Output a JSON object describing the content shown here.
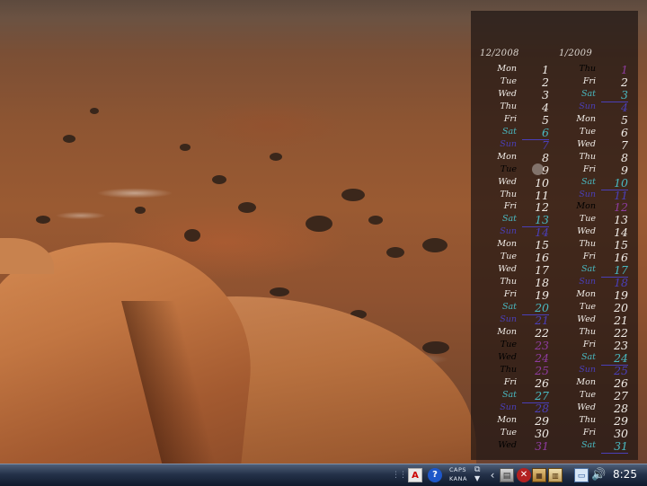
{
  "calendar": {
    "months": [
      {
        "heading": "12/2008",
        "days": [
          {
            "name": "Mon",
            "date": "1",
            "kind": "weekday"
          },
          {
            "name": "Tue",
            "date": "2",
            "kind": "weekday"
          },
          {
            "name": "Wed",
            "date": "3",
            "kind": "weekday"
          },
          {
            "name": "Thu",
            "date": "4",
            "kind": "weekday"
          },
          {
            "name": "Fri",
            "date": "5",
            "kind": "weekday"
          },
          {
            "name": "Sat",
            "date": "6",
            "kind": "sat"
          },
          {
            "name": "Sun",
            "date": "7",
            "kind": "sun"
          },
          {
            "name": "Mon",
            "date": "8",
            "kind": "weekday"
          },
          {
            "name": "Tue",
            "date": "9",
            "kind": "today"
          },
          {
            "name": "Wed",
            "date": "10",
            "kind": "weekday"
          },
          {
            "name": "Thu",
            "date": "11",
            "kind": "weekday"
          },
          {
            "name": "Fri",
            "date": "12",
            "kind": "weekday"
          },
          {
            "name": "Sat",
            "date": "13",
            "kind": "sat"
          },
          {
            "name": "Sun",
            "date": "14",
            "kind": "sun"
          },
          {
            "name": "Mon",
            "date": "15",
            "kind": "weekday"
          },
          {
            "name": "Tue",
            "date": "16",
            "kind": "weekday"
          },
          {
            "name": "Wed",
            "date": "17",
            "kind": "weekday"
          },
          {
            "name": "Thu",
            "date": "18",
            "kind": "weekday"
          },
          {
            "name": "Fri",
            "date": "19",
            "kind": "weekday"
          },
          {
            "name": "Sat",
            "date": "20",
            "kind": "sat"
          },
          {
            "name": "Sun",
            "date": "21",
            "kind": "sun"
          },
          {
            "name": "Mon",
            "date": "22",
            "kind": "weekday"
          },
          {
            "name": "Tue",
            "date": "23",
            "kind": "holiday"
          },
          {
            "name": "Wed",
            "date": "24",
            "kind": "holiday"
          },
          {
            "name": "Thu",
            "date": "25",
            "kind": "holiday"
          },
          {
            "name": "Fri",
            "date": "26",
            "kind": "weekday"
          },
          {
            "name": "Sat",
            "date": "27",
            "kind": "sat"
          },
          {
            "name": "Sun",
            "date": "28",
            "kind": "sun"
          },
          {
            "name": "Mon",
            "date": "29",
            "kind": "weekday"
          },
          {
            "name": "Tue",
            "date": "30",
            "kind": "weekday"
          },
          {
            "name": "Wed",
            "date": "31",
            "kind": "holiday"
          }
        ]
      },
      {
        "heading": "1/2009",
        "days": [
          {
            "name": "Thu",
            "date": "1",
            "kind": "holiday"
          },
          {
            "name": "Fri",
            "date": "2",
            "kind": "weekday"
          },
          {
            "name": "Sat",
            "date": "3",
            "kind": "sat"
          },
          {
            "name": "Sun",
            "date": "4",
            "kind": "sun"
          },
          {
            "name": "Mon",
            "date": "5",
            "kind": "weekday"
          },
          {
            "name": "Tue",
            "date": "6",
            "kind": "weekday"
          },
          {
            "name": "Wed",
            "date": "7",
            "kind": "weekday"
          },
          {
            "name": "Thu",
            "date": "8",
            "kind": "weekday"
          },
          {
            "name": "Fri",
            "date": "9",
            "kind": "weekday"
          },
          {
            "name": "Sat",
            "date": "10",
            "kind": "sat"
          },
          {
            "name": "Sun",
            "date": "11",
            "kind": "sun"
          },
          {
            "name": "Mon",
            "date": "12",
            "kind": "holiday"
          },
          {
            "name": "Tue",
            "date": "13",
            "kind": "weekday"
          },
          {
            "name": "Wed",
            "date": "14",
            "kind": "weekday"
          },
          {
            "name": "Thu",
            "date": "15",
            "kind": "weekday"
          },
          {
            "name": "Fri",
            "date": "16",
            "kind": "weekday"
          },
          {
            "name": "Sat",
            "date": "17",
            "kind": "sat"
          },
          {
            "name": "Sun",
            "date": "18",
            "kind": "sun"
          },
          {
            "name": "Mon",
            "date": "19",
            "kind": "weekday"
          },
          {
            "name": "Tue",
            "date": "20",
            "kind": "weekday"
          },
          {
            "name": "Wed",
            "date": "21",
            "kind": "weekday"
          },
          {
            "name": "Thu",
            "date": "22",
            "kind": "weekday"
          },
          {
            "name": "Fri",
            "date": "23",
            "kind": "weekday"
          },
          {
            "name": "Sat",
            "date": "24",
            "kind": "sat"
          },
          {
            "name": "Sun",
            "date": "25",
            "kind": "sun"
          },
          {
            "name": "Mon",
            "date": "26",
            "kind": "weekday"
          },
          {
            "name": "Tue",
            "date": "27",
            "kind": "weekday"
          },
          {
            "name": "Wed",
            "date": "28",
            "kind": "weekday"
          },
          {
            "name": "Thu",
            "date": "29",
            "kind": "weekday"
          },
          {
            "name": "Fri",
            "date": "30",
            "kind": "weekday"
          },
          {
            "name": "Sat",
            "date": "31",
            "kind": "sat"
          }
        ]
      }
    ],
    "colors": {
      "weekday": "#f1ede8",
      "saturday": "#49b8c0",
      "sunday": "#4a3fb8",
      "holiday": "#8d3c9e"
    }
  },
  "taskbar": {
    "ime": {
      "caps_label": "CAPS",
      "kana_label": "KANA"
    },
    "tray_icons": [
      "adobe-reader-icon",
      "help-icon",
      "ime-toolbar-icon",
      "show-hidden-icons-chevron",
      "app-icon",
      "security-shield-icon",
      "app-icon",
      "app-icon",
      "network-icon",
      "volume-icon"
    ],
    "clock": "8:25"
  }
}
